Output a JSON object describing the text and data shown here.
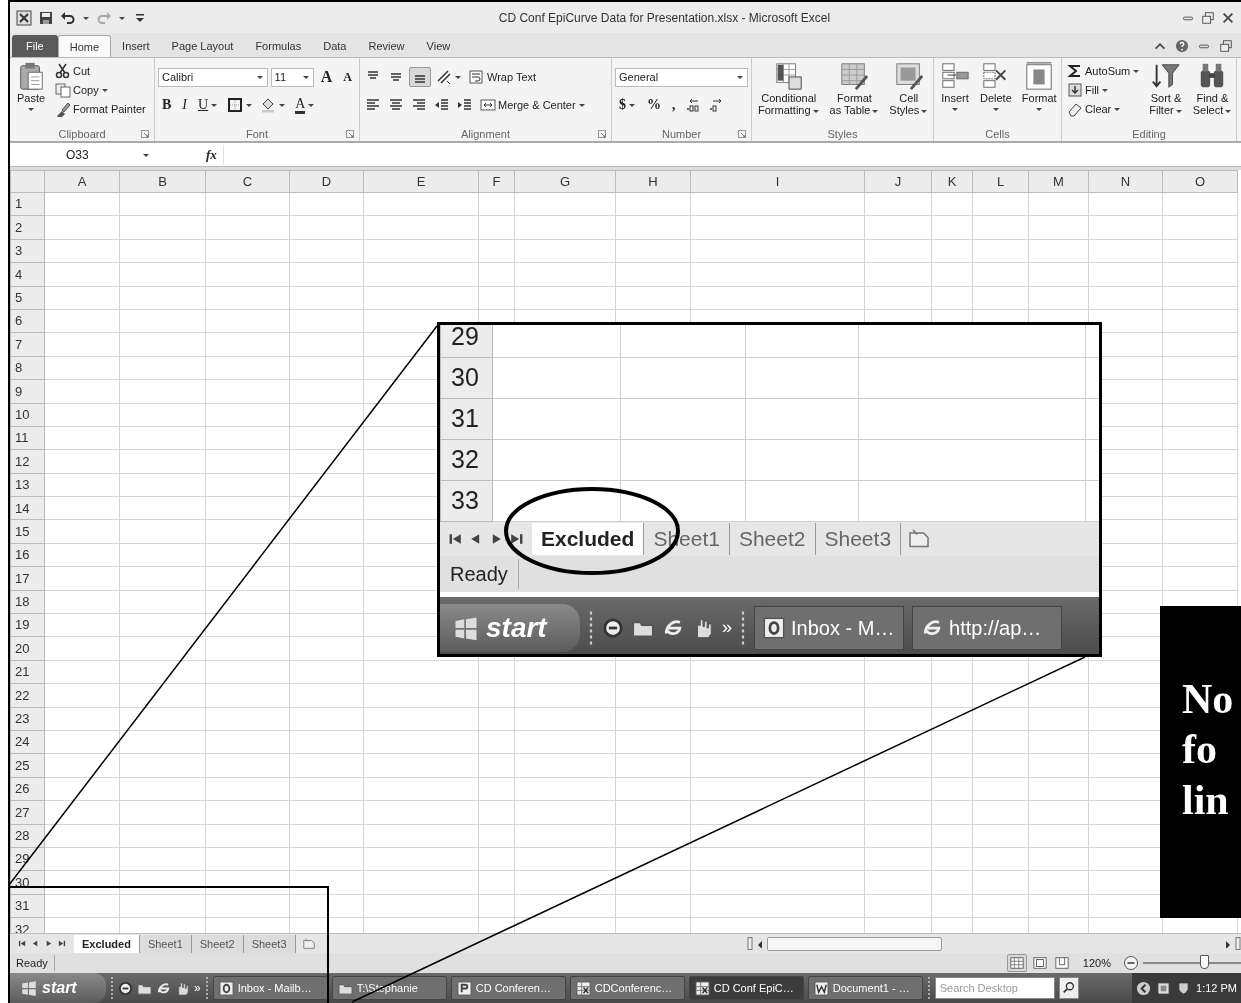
{
  "window": {
    "title": "CD Conf EpiCurve Data for Presentation.xlsx  -  Microsoft Excel"
  },
  "ribbon": {
    "tabs": [
      {
        "label": "File",
        "kind": "file",
        "selected": false
      },
      {
        "label": "Home",
        "kind": "tab",
        "selected": true
      },
      {
        "label": "Insert",
        "kind": "tab",
        "selected": false
      },
      {
        "label": "Page Layout",
        "kind": "tab",
        "selected": false
      },
      {
        "label": "Formulas",
        "kind": "tab",
        "selected": false
      },
      {
        "label": "Data",
        "kind": "tab",
        "selected": false
      },
      {
        "label": "Review",
        "kind": "tab",
        "selected": false
      },
      {
        "label": "View",
        "kind": "tab",
        "selected": false
      }
    ],
    "groups": [
      {
        "label": "Clipboard",
        "kind": "columns",
        "items": [
          [
            {
              "kind": "large",
              "lines": [
                "Paste"
              ]
            }
          ],
          [
            {
              "kind": "small",
              "label": "Cut"
            },
            {
              "kind": "small",
              "label": "Copy"
            },
            {
              "kind": "small",
              "label": "Format Painter"
            }
          ]
        ]
      },
      {
        "label": "Font",
        "kind": "rows",
        "items": [
          [
            {
              "kind": "combo",
              "value": "Calibri"
            },
            {
              "kind": "combo-narrow",
              "value": "11"
            },
            {
              "kind": "glyph",
              "label": "A"
            },
            {
              "kind": "glyph",
              "label": "A"
            }
          ],
          [
            {
              "kind": "glyph",
              "label": "B"
            },
            {
              "kind": "glyph",
              "label": "I"
            },
            {
              "kind": "glyph",
              "label": "U"
            },
            {
              "kind": "icon"
            },
            {
              "kind": "icon"
            },
            {
              "kind": "glyph",
              "label": "A"
            }
          ]
        ]
      },
      {
        "label": "Alignment",
        "kind": "rows",
        "items": [
          [
            {
              "kind": "icon",
              "pressed": false
            },
            {
              "kind": "icon",
              "pressed": false
            },
            {
              "kind": "icon",
              "pressed": true
            },
            {
              "kind": "icon",
              "pressed": false
            },
            {
              "kind": "small",
              "label": "Wrap Text",
              "pressed": false
            }
          ],
          [
            {
              "kind": "icon",
              "pressed": false
            },
            {
              "kind": "icon",
              "pressed": false
            },
            {
              "kind": "icon",
              "pressed": false
            },
            {
              "kind": "icon",
              "pressed": false
            },
            {
              "kind": "icon",
              "pressed": false
            },
            {
              "kind": "small",
              "label": "Merge & Center",
              "pressed": false
            }
          ]
        ]
      },
      {
        "label": "Number",
        "kind": "rows",
        "items": [
          [
            {
              "kind": "combo",
              "value": "General"
            }
          ],
          [
            {
              "kind": "glyph",
              "label": "$"
            },
            {
              "kind": "glyph",
              "label": "%"
            },
            {
              "kind": "glyph",
              "label": ","
            },
            {
              "kind": "icon"
            },
            {
              "kind": "icon"
            }
          ]
        ]
      },
      {
        "label": "Styles",
        "kind": "columns",
        "items": [
          [
            {
              "kind": "large",
              "lines": [
                "Conditional",
                "Formatting"
              ]
            }
          ],
          [
            {
              "kind": "large",
              "lines": [
                "Format",
                "as Table"
              ]
            }
          ],
          [
            {
              "kind": "large",
              "lines": [
                "Cell",
                "Styles"
              ]
            }
          ]
        ]
      },
      {
        "label": "Cells",
        "kind": "columns",
        "items": [
          [
            {
              "kind": "large",
              "lines": [
                "Insert"
              ]
            }
          ],
          [
            {
              "kind": "large",
              "lines": [
                "Delete"
              ]
            }
          ],
          [
            {
              "kind": "large",
              "lines": [
                "Format"
              ]
            }
          ]
        ]
      },
      {
        "label": "Editing",
        "kind": "columns",
        "items": [
          [
            {
              "kind": "small",
              "label": "AutoSum"
            },
            {
              "kind": "small",
              "label": "Fill"
            },
            {
              "kind": "small",
              "label": "Clear"
            }
          ],
          [
            {
              "kind": "large",
              "lines": [
                "Sort &",
                "Filter"
              ]
            }
          ],
          [
            {
              "kind": "large",
              "lines": [
                "Find &",
                "Select"
              ]
            }
          ]
        ]
      }
    ]
  },
  "formula_bar": {
    "name_box": "O33",
    "function_label": "fx"
  },
  "sheet": {
    "columns": [
      "A",
      "B",
      "C",
      "D",
      "E",
      "F",
      "G",
      "H",
      "I",
      "J",
      "K",
      "L",
      "M",
      "N",
      "O"
    ],
    "rows": [
      "1",
      "2",
      "3",
      "4",
      "5",
      "6",
      "7",
      "8",
      "9",
      "10",
      "11",
      "12",
      "13",
      "14",
      "15",
      "16",
      "17",
      "18",
      "19",
      "20",
      "21",
      "22",
      "23",
      "24",
      "25",
      "26",
      "27",
      "28",
      "29",
      "30",
      "31",
      "32"
    ]
  },
  "sheet_tabs": [
    {
      "label": "Excluded",
      "selected": true
    },
    {
      "label": "Sheet1",
      "selected": false
    },
    {
      "label": "Sheet2",
      "selected": false
    },
    {
      "label": "Sheet3",
      "selected": false
    }
  ],
  "status_bar": {
    "text": "Ready",
    "views": [
      {
        "selected": true
      },
      {
        "selected": false
      },
      {
        "selected": false
      }
    ],
    "zoom": "120%",
    "zoom_slider": {
      "level": 0.55
    }
  },
  "taskbar": {
    "start": "start",
    "overflow": "»",
    "buttons": [
      {
        "label": "Inbox - Mailb…",
        "selected": false
      },
      {
        "label": "T:\\Stephanie",
        "selected": false
      },
      {
        "label": "CD Conferen…",
        "selected": false
      },
      {
        "label": "CDConferenc…",
        "selected": false
      },
      {
        "label": "CD Conf EpiC…",
        "selected": true
      },
      {
        "label": "Document1 - …",
        "selected": false
      }
    ],
    "search": {
      "placeholder": "Search Desktop"
    },
    "clock": "1:12 PM"
  },
  "zoom_inset": {
    "rows": [
      "29",
      "30",
      "31",
      "32",
      "33"
    ],
    "sheet_tabs": [
      {
        "label": "Excluded",
        "selected": true
      },
      {
        "label": "Sheet1",
        "selected": false
      },
      {
        "label": "Sheet2",
        "selected": false
      },
      {
        "label": "Sheet3",
        "selected": false
      }
    ],
    "status": "Ready",
    "taskbar": {
      "start": "start",
      "overflow": "»",
      "buttons": [
        {
          "label": "Inbox - M…"
        },
        {
          "label": "http://ap…"
        }
      ]
    }
  },
  "callout": {
    "lines": [
      "No",
      "fo",
      "lin"
    ]
  }
}
